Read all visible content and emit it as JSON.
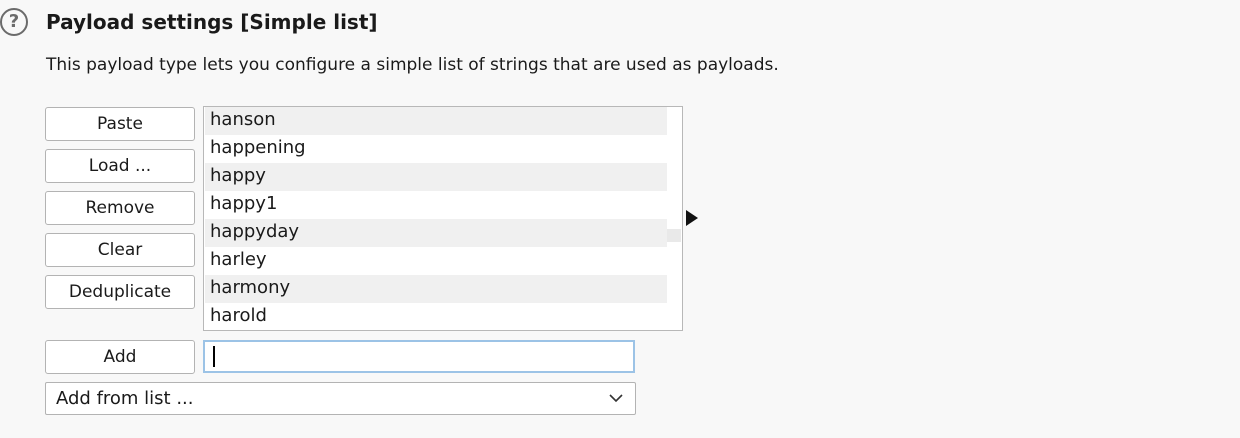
{
  "header": {
    "help_icon_glyph": "?",
    "title": "Payload settings [Simple list]",
    "description": "This payload type lets you configure a simple list of strings that are used as payloads."
  },
  "buttons": {
    "paste": "Paste",
    "load": "Load ...",
    "remove": "Remove",
    "clear": "Clear",
    "deduplicate": "Deduplicate",
    "add": "Add"
  },
  "payload_list": {
    "items": [
      "hanson",
      "happening",
      "happy",
      "happy1",
      "happyday",
      "harley",
      "harmony",
      "harold"
    ]
  },
  "add_input": {
    "value": "",
    "placeholder": ""
  },
  "add_from_list": {
    "selected": "Add from list ..."
  },
  "icons": {
    "help": "help-circle-icon",
    "expand_arrow": "triangle-right-icon",
    "dropdown": "chevron-down-icon"
  }
}
